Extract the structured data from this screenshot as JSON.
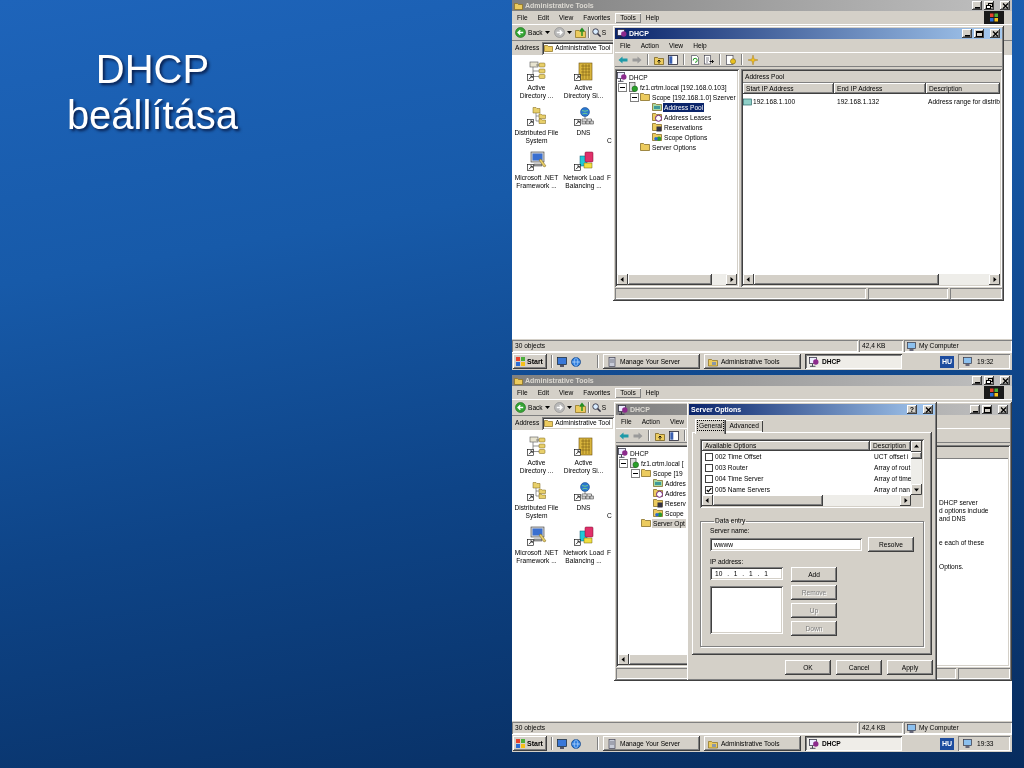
{
  "slide": {
    "title": "DHCP beállítása"
  },
  "screenshots": [
    {
      "explorer": {
        "title": "Administrative Tools",
        "active": false,
        "menu": [
          {
            "label": "File",
            "selected": false
          },
          {
            "label": "Edit",
            "selected": false
          },
          {
            "label": "View",
            "selected": false
          },
          {
            "label": "Favorites",
            "selected": false
          },
          {
            "label": "Tools",
            "selected": true
          },
          {
            "label": "Help",
            "selected": false
          }
        ],
        "toolbar": {
          "back": "Back",
          "search": "S"
        },
        "address": {
          "label": "Address",
          "value": "Administrative Tool"
        },
        "items": [
          [
            {
              "kind": "shortcut",
              "label": [
                "Active",
                "Directory ..."
              ]
            },
            {
              "kind": "shortcut",
              "label": [
                "Active",
                "Directory Si..."
              ]
            }
          ],
          [
            {
              "kind": "shortcut",
              "label": [
                "Distributed File",
                "System"
              ]
            },
            {
              "kind": "shortcut",
              "label": [
                "DNS"
              ]
            },
            {
              "kind": "clipped",
              "label": [
                "C"
              ]
            }
          ],
          [
            {
              "kind": "shortcut",
              "label": [
                "Microsoft .NET",
                "Framework ..."
              ]
            },
            {
              "kind": "shortcut",
              "label": [
                "Network Load",
                "Balancing ..."
              ]
            },
            {
              "kind": "clipped",
              "label": [
                "F"
              ]
            }
          ]
        ],
        "status_bar": [
          "30 objects",
          "42,4 KB",
          "My Computer"
        ]
      },
      "taskbar": {
        "start": "Start",
        "buttons": [
          {
            "label": "Manage Your Server",
            "selected": false
          },
          {
            "label": "Administrative Tools",
            "selected": false
          },
          {
            "label": "DHCP",
            "selected": true
          }
        ],
        "language": "HU",
        "clock": "19:32"
      },
      "dhcp": {
        "title": "DHCP",
        "active": true,
        "menu": [
          "File",
          "Action",
          "View",
          "Help"
        ],
        "tree": [
          {
            "label": "DHCP",
            "selected": false,
            "children": [
              {
                "label": "fz1.crtm.local [192.168.0.103]",
                "expanded": true,
                "selected": false,
                "children": [
                  {
                    "label": "Scope [192.168.1.0] Szerver",
                    "expanded": true,
                    "selected": false,
                    "children": [
                      {
                        "label": "Address Pool",
                        "selected": true
                      },
                      {
                        "label": "Address Leases",
                        "selected": false
                      },
                      {
                        "label": "Reservations",
                        "selected": false
                      },
                      {
                        "label": "Scope Options",
                        "selected": false
                      }
                    ]
                  },
                  {
                    "label": "Server Options",
                    "selected": false
                  }
                ]
              }
            ]
          }
        ],
        "details": {
          "kind": "table",
          "heading": "Address Pool",
          "columns": [
            "Start IP Address",
            "End IP Address",
            "Description"
          ],
          "rows": [
            [
              "192.168.1.100",
              "192.168.1.132",
              "Address range for distrib"
            ]
          ]
        }
      }
    },
    {
      "explorer": {
        "title": "Administrative Tools",
        "active": false,
        "menu": [
          {
            "label": "File",
            "selected": false
          },
          {
            "label": "Edit",
            "selected": false
          },
          {
            "label": "View",
            "selected": false
          },
          {
            "label": "Favorites",
            "selected": false
          },
          {
            "label": "Tools",
            "selected": true
          },
          {
            "label": "Help",
            "selected": false
          }
        ],
        "toolbar": {
          "back": "Back",
          "search": "S"
        },
        "address": {
          "label": "Address",
          "value": "Administrative Tool"
        },
        "items": [
          [
            {
              "kind": "shortcut",
              "label": [
                "Active",
                "Directory ..."
              ]
            },
            {
              "kind": "shortcut",
              "label": [
                "Active",
                "Directory Si..."
              ]
            }
          ],
          [
            {
              "kind": "shortcut",
              "label": [
                "Distributed File",
                "System"
              ]
            },
            {
              "kind": "shortcut",
              "label": [
                "DNS"
              ]
            },
            {
              "kind": "clipped",
              "label": [
                "C"
              ]
            }
          ],
          [
            {
              "kind": "shortcut",
              "label": [
                "Microsoft .NET",
                "Framework ..."
              ]
            },
            {
              "kind": "shortcut",
              "label": [
                "Network Load",
                "Balancing ..."
              ]
            },
            {
              "kind": "clipped",
              "label": [
                "F"
              ]
            }
          ]
        ],
        "status_bar": [
          "30 objects",
          "42,4 KB",
          "My Computer"
        ]
      },
      "taskbar": {
        "start": "Start",
        "buttons": [
          {
            "label": "Manage Your Server",
            "selected": false
          },
          {
            "label": "Administrative Tools",
            "selected": false
          },
          {
            "label": "DHCP",
            "selected": true
          }
        ],
        "language": "HU",
        "clock": "19:33"
      },
      "dhcp": {
        "title": "DHCP",
        "active": false,
        "menu": [
          "File",
          "Action",
          "View"
        ],
        "tree": [
          {
            "label": "DHCP",
            "selected": false,
            "children": [
              {
                "label": "fz1.crtm.local [",
                "expanded": true,
                "selected": false,
                "children": [
                  {
                    "label": "Scope [19",
                    "expanded": true,
                    "selected": false,
                    "children": [
                      {
                        "label": "Addres",
                        "selected": false
                      },
                      {
                        "label": "Addres",
                        "selected": false
                      },
                      {
                        "label": "Reserv",
                        "selected": false
                      },
                      {
                        "label": "Scope",
                        "selected": false
                      }
                    ]
                  },
                  {
                    "label": "Server Opt",
                    "selected": true
                  }
                ]
              }
            ]
          }
        ],
        "details": {
          "kind": "text",
          "paragraphs": [
            [
              "DHCP server",
              "d options include",
              "and DNS"
            ],
            [
              "e each of these"
            ],
            [
              "Options."
            ]
          ]
        }
      },
      "dialog": {
        "title": "Server Options",
        "help": "?",
        "tabs": [
          {
            "label": "General",
            "selected": true
          },
          {
            "label": "Advanced",
            "selected": false
          }
        ],
        "options": {
          "columns": [
            "Available Options",
            "Description"
          ],
          "rows": [
            {
              "name": "002 Time Offset",
              "description": "UCT offset i",
              "checked": false
            },
            {
              "name": "003 Router",
              "description": "Array of rout",
              "checked": false
            },
            {
              "name": "004 Time Server",
              "description": "Array of time",
              "checked": false
            },
            {
              "name": "005 Name Servers",
              "description": "Array of nan",
              "checked": true
            }
          ]
        },
        "group": "Data entry",
        "server_name": {
          "label": "Server name:",
          "value": "wwww"
        },
        "resolve": "Resolve",
        "ip_address": {
          "label": "IP address:",
          "value": "10 . 1 . 1 . 1"
        },
        "list_buttons": [
          {
            "label": "Add",
            "disabled": false
          },
          {
            "label": "Remove",
            "disabled": true
          },
          {
            "label": "Up",
            "disabled": true
          },
          {
            "label": "Down",
            "disabled": true
          }
        ],
        "buttons": [
          "OK",
          "Cancel",
          "Apply"
        ]
      }
    }
  ]
}
